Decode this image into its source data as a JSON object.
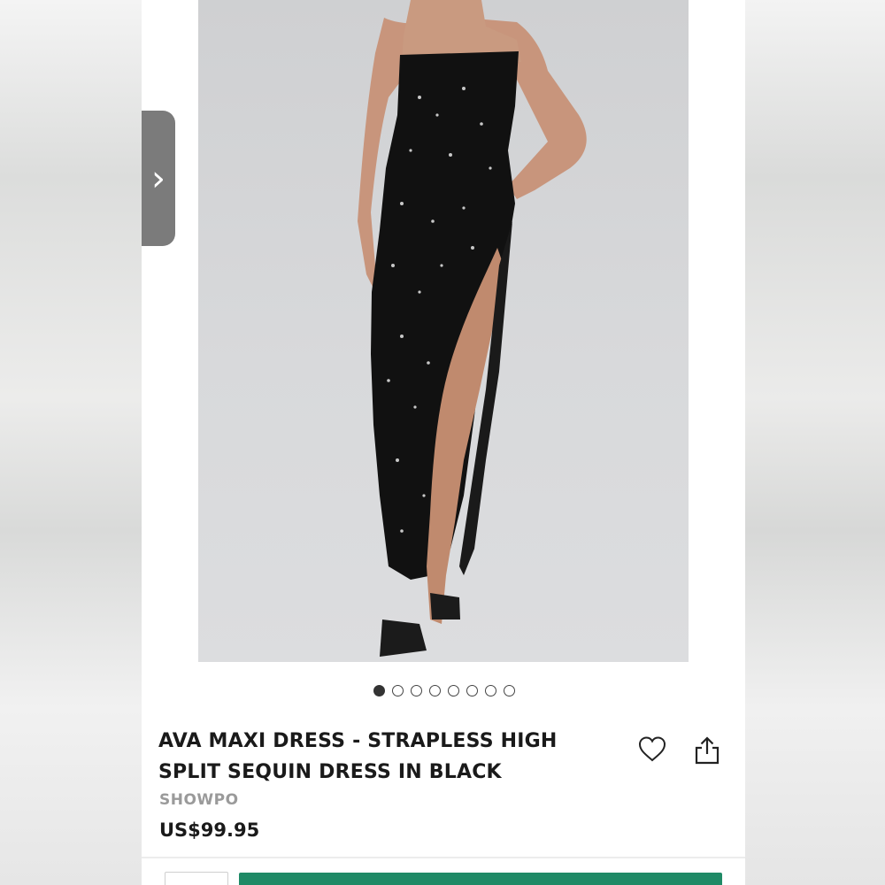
{
  "product": {
    "title_line1": "AVA MAXI DRESS - STRAPLESS HIGH",
    "title_line2": "SPLIT SEQUIN DRESS IN BLACK",
    "brand": "SHOWPO",
    "price": "US$99.95"
  },
  "gallery": {
    "image_count": 8,
    "active_index": 0,
    "next_glyph": "›"
  },
  "icons": {
    "favorite": "heart-icon",
    "share": "share-icon",
    "next": "chevron-right-icon"
  },
  "colors": {
    "add_to_bag": "#1f8a66",
    "side_tab": "#7b7b7b",
    "brand_text": "#9a9a9a"
  }
}
